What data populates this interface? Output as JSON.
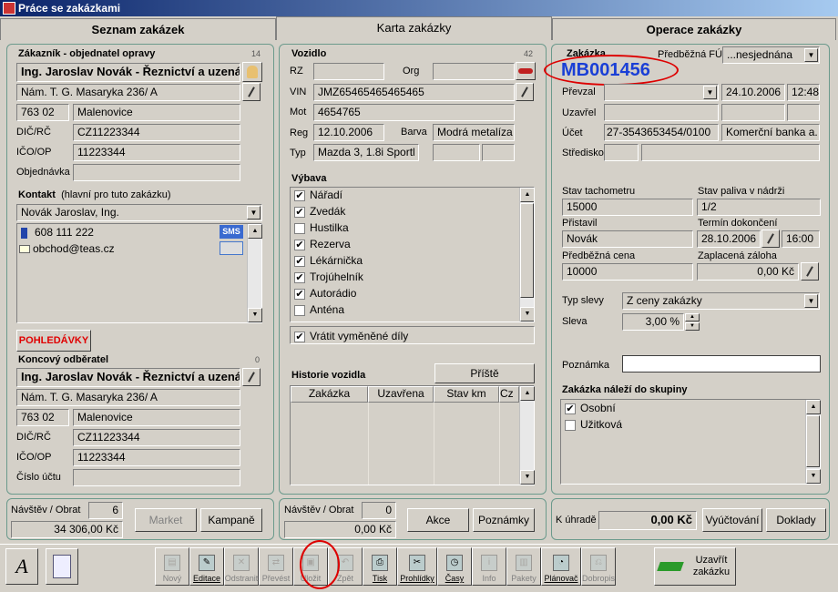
{
  "window": {
    "title": "Práce se zakázkami"
  },
  "tabs": [
    "Seznam zakázek",
    "Karta zakázky",
    "Operace zakázky"
  ],
  "customer": {
    "title": "Zákazník - objednatel opravy",
    "count": "14",
    "name": "Ing. Jaroslav Novák - Řeznictví a uzenái",
    "street": "Nám. T. G. Masaryka 236/ A",
    "zip": "763 02",
    "city": "Malenovice",
    "dic_label": "DIČ/RČ",
    "dic": "CZ11223344",
    "ico_label": "IČO/OP",
    "ico": "11223344",
    "order_label": "Objednávka",
    "order": ""
  },
  "contact": {
    "title": "Kontakt",
    "subtitle": "(hlavní pro tuto zakázku)",
    "person": "Novák Jaroslav, Ing.",
    "phone": "608 111 222",
    "sms": "SMS",
    "email": "obchod@teas.cz"
  },
  "claims_button": "POHLEDÁVKY",
  "final": {
    "title": "Koncový odběratel",
    "count": "0",
    "name": "Ing. Jaroslav Novák - Řeznictví a uzenái",
    "street": "Nám. T. G. Masaryka 236/ A",
    "zip": "763 02",
    "city": "Malenovice",
    "dic_label": "DIČ/RČ",
    "dic": "CZ11223344",
    "ico_label": "IČO/OP",
    "ico": "11223344",
    "account_label": "Číslo účtu",
    "account": ""
  },
  "left_stats": {
    "label": "Návštěv / Obrat",
    "visits": "6",
    "turnover": "34 306,00 Kč",
    "market": "Market",
    "campaigns": "Kampaně"
  },
  "vehicle": {
    "title": "Vozidlo",
    "count": "42",
    "rz_label": "RZ",
    "rz": "",
    "org_label": "Org",
    "org": "",
    "vin_label": "VIN",
    "vin": "JMZ65465465465465",
    "mot_label": "Mot",
    "mot": "4654765",
    "reg_label": "Reg",
    "reg": "12.10.2006",
    "color_label": "Barva",
    "color": "Modrá metalíza",
    "type_label": "Typ",
    "type": "Mazda 3, 1.8i Sportl"
  },
  "equipment": {
    "title": "Výbava",
    "items": [
      {
        "label": "Nářadí",
        "checked": true
      },
      {
        "label": "Zvedák",
        "checked": true
      },
      {
        "label": "Hustilka",
        "checked": false
      },
      {
        "label": "Rezerva",
        "checked": true
      },
      {
        "label": "Lékárnička",
        "checked": true
      },
      {
        "label": "Trojúhelník",
        "checked": true
      },
      {
        "label": "Autorádio",
        "checked": true
      },
      {
        "label": "Anténa",
        "checked": false
      }
    ],
    "return_parts": "Vrátit vyměněné díly"
  },
  "history": {
    "title": "Historie vozidla",
    "next": "Příště",
    "columns": [
      "Zakázka",
      "Uzavřena",
      "Stav km",
      "Cz"
    ]
  },
  "mid_stats": {
    "label": "Návštěv / Obrat",
    "visits": "0",
    "turnover": "0,00 Kč",
    "actions": "Akce",
    "notes": "Poznámky"
  },
  "order": {
    "title": "Zakázka",
    "prelim_label": "Předběžná FÚ",
    "prelim": "...nesjednána",
    "number": "MB001456",
    "received_label": "Převzal",
    "received_date": "24.10.2006",
    "received_time": "12:48",
    "closed_label": "Uzavřel",
    "account_label": "Účet",
    "account": "27-3543653454/0100",
    "bank": "Komerční banka a.",
    "center_label": "Středisko",
    "odo_label": "Stav tachometru",
    "odo": "15000",
    "fuel_label": "Stav paliva v nádrži",
    "fuel": "1/2",
    "deliv_label": "Přistavil",
    "deliv": "Novák",
    "done_label": "Termín dokončení",
    "done_date": "28.10.2006",
    "done_time": "16:00",
    "price_label": "Předběžná cena",
    "price": "10000",
    "deposit_label": "Zaplacená záloha",
    "deposit": "0,00 Kč",
    "disc_type_label": "Typ slevy",
    "disc_type": "Z ceny zakázky",
    "disc_label": "Sleva",
    "disc": "3,00 %",
    "note_label": "Poznámka",
    "note": "",
    "groups_title": "Zakázka náleží do skupiny",
    "groups": [
      {
        "label": "Osobní",
        "checked": true
      },
      {
        "label": "Užitková",
        "checked": false
      }
    ]
  },
  "right_stats": {
    "label": "K úhradě",
    "amount": "0,00 Kč",
    "settle": "Vyúčtování",
    "docs": "Doklady"
  },
  "toolbar": {
    "buttons": [
      {
        "label": "Nový",
        "enabled": false
      },
      {
        "label": "Editace",
        "enabled": true
      },
      {
        "label": "Odstranit",
        "enabled": false
      },
      {
        "label": "Převést",
        "enabled": false
      },
      {
        "label": "Uložit",
        "enabled": false
      },
      {
        "label": "Zpět",
        "enabled": false
      },
      {
        "label": "Tisk",
        "enabled": true
      },
      {
        "label": "Prohlídky",
        "enabled": true
      },
      {
        "label": "Časy",
        "enabled": true
      },
      {
        "label": "Info",
        "enabled": false
      },
      {
        "label": "Pakety",
        "enabled": false
      },
      {
        "label": "Plánovač",
        "enabled": true
      },
      {
        "label": "Dobropis",
        "enabled": false
      }
    ],
    "close_order": "Uzavřít zakázku"
  }
}
